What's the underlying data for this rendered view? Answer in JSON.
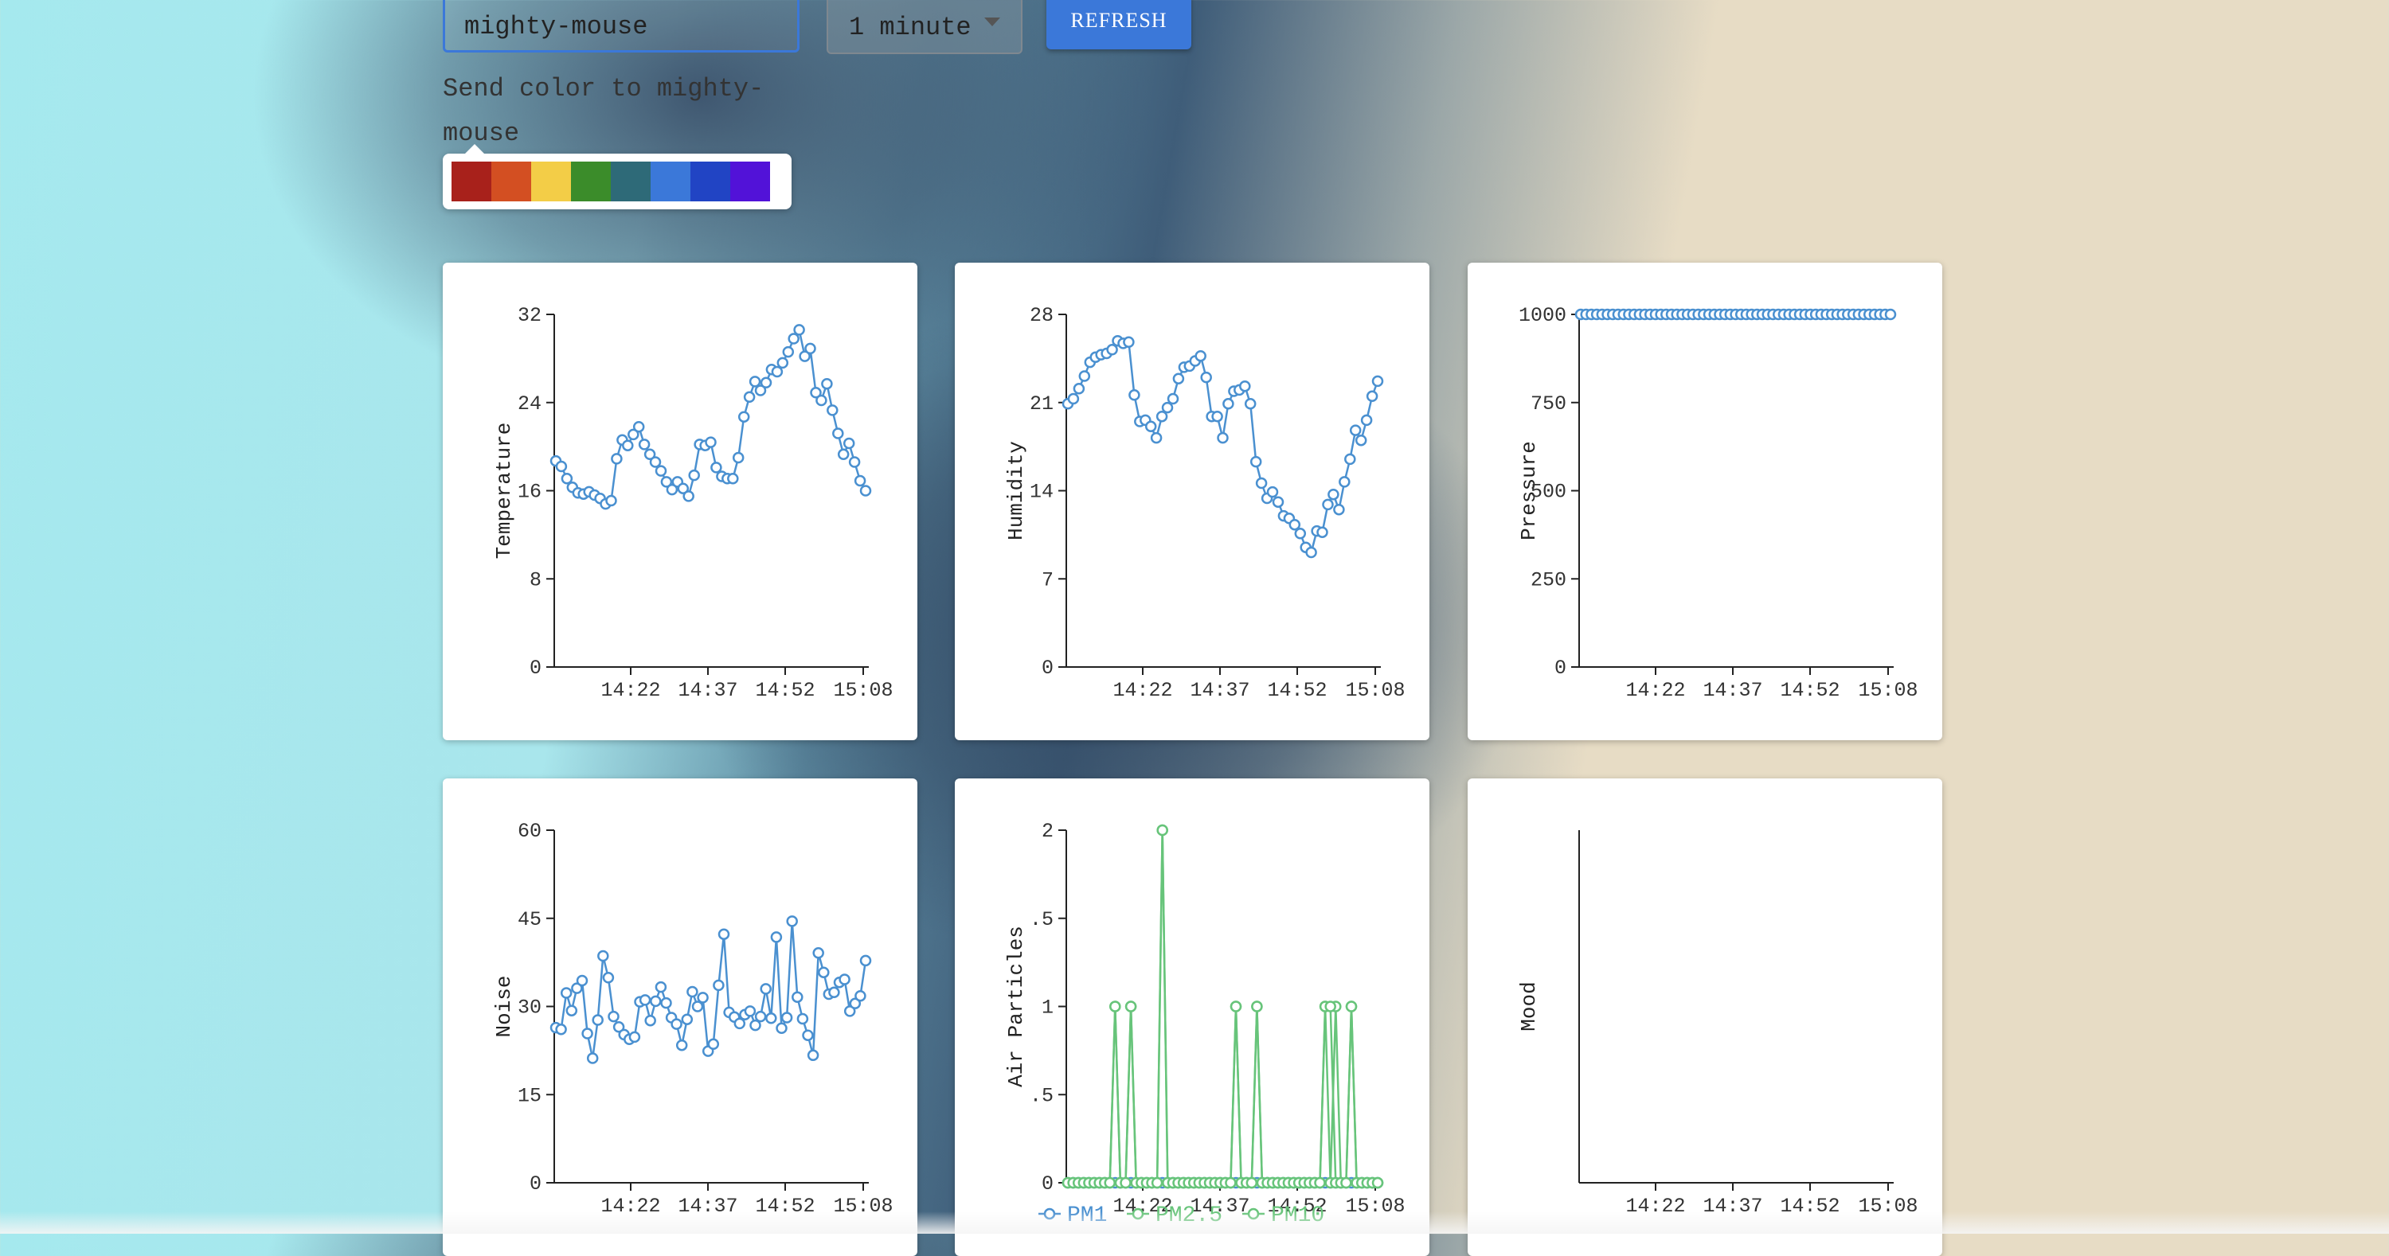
{
  "controls": {
    "device_value": "mighty-mouse",
    "interval_value": "1 minute",
    "refresh_label": "REFRESH",
    "send_color_label": "Send color to mighty-mouse",
    "palette_colors": [
      "#a8211b",
      "#d34f22",
      "#f3cd47",
      "#3b8c2a",
      "#2e6a78",
      "#3b78d9",
      "#2144c4",
      "#5212d8"
    ]
  },
  "colors": {
    "accent": "#3b78d9",
    "series_blue": "#4a90d0",
    "series_green": "#67c47a"
  },
  "chart_data": [
    {
      "type": "line",
      "ylabel": "Temperature",
      "ylim": [
        0,
        32
      ],
      "yticks": [
        0,
        8,
        16,
        24,
        32
      ],
      "xticks": [
        "14:22",
        "14:37",
        "14:52",
        "15:08"
      ],
      "series": [
        {
          "color": "#4a90d0",
          "values": [
            18.7,
            18.2,
            17.1,
            16.3,
            15.8,
            15.7,
            15.9,
            15.6,
            15.3,
            14.8,
            15.1,
            18.9,
            20.6,
            20.1,
            21.1,
            21.8,
            20.2,
            19.3,
            18.6,
            17.8,
            16.8,
            16.1,
            16.8,
            16.2,
            15.5,
            17.4,
            20.2,
            20.1,
            20.4,
            18.1,
            17.3,
            17.1,
            17.1,
            19.0,
            22.7,
            24.5,
            25.9,
            25.1,
            25.8,
            27.0,
            26.8,
            27.6,
            28.6,
            29.8,
            30.6,
            28.2,
            28.9,
            24.9,
            24.2,
            25.7,
            23.3,
            21.2,
            19.3,
            20.3,
            18.6,
            16.9,
            16.0
          ]
        }
      ]
    },
    {
      "type": "line",
      "ylabel": "Humidity",
      "ylim": [
        0,
        28
      ],
      "yticks": [
        0,
        7,
        14,
        21,
        28
      ],
      "xticks": [
        "14:22",
        "14:37",
        "14:52",
        "15:08"
      ],
      "series": [
        {
          "color": "#4a90d0",
          "values": [
            20.9,
            21.3,
            22.1,
            23.1,
            24.2,
            24.6,
            24.8,
            24.9,
            25.2,
            25.9,
            25.7,
            25.8,
            21.6,
            19.5,
            19.6,
            19.1,
            18.2,
            19.9,
            20.6,
            21.3,
            22.9,
            23.8,
            23.9,
            24.3,
            24.7,
            23.0,
            19.9,
            19.9,
            18.2,
            20.9,
            21.9,
            22.0,
            22.3,
            20.9,
            16.3,
            14.6,
            13.4,
            13.9,
            13.1,
            12.0,
            11.8,
            11.3,
            10.6,
            9.5,
            9.1,
            10.8,
            10.7,
            12.9,
            13.7,
            12.5,
            14.7,
            16.5,
            18.8,
            18.0,
            19.6,
            21.5,
            22.7
          ]
        }
      ]
    },
    {
      "type": "line",
      "ylabel": "Pressure",
      "ylim": [
        0,
        1000
      ],
      "yticks": [
        0,
        250,
        500,
        750,
        1000
      ],
      "xticks": [
        "14:22",
        "14:37",
        "14:52",
        "15:08"
      ],
      "series": [
        {
          "color": "#4a90d0",
          "values": [
            1000,
            1000,
            1000,
            1000,
            1000,
            1000,
            1000,
            1000,
            1000,
            1000,
            1000,
            1000,
            1000,
            1000,
            1000,
            1000,
            1000,
            1000,
            1000,
            1000,
            1000,
            1000,
            1000,
            1000,
            1000,
            1000,
            1000,
            1000,
            1000,
            1000,
            1000,
            1000,
            1000,
            1000,
            1000,
            1000,
            1000,
            1000,
            1000,
            1000,
            1000,
            1000,
            1000,
            1000,
            1000,
            1000,
            1000,
            1000,
            1000,
            1000,
            1000,
            1000,
            1000,
            1000,
            1000,
            1000,
            1000,
            1000,
            1000
          ]
        }
      ]
    },
    {
      "type": "line",
      "ylabel": "Noise",
      "ylim": [
        0,
        60
      ],
      "yticks": [
        0,
        15,
        30,
        45,
        60
      ],
      "xticks": [
        "14:22",
        "14:37",
        "14:52",
        "15:08"
      ],
      "series": [
        {
          "color": "#4a90d0",
          "values": [
            26.4,
            26.1,
            32.3,
            29.3,
            33.1,
            34.4,
            25.4,
            21.2,
            27.7,
            38.6,
            34.9,
            28.3,
            26.5,
            25.2,
            24.4,
            24.8,
            30.8,
            31.1,
            27.6,
            30.9,
            33.3,
            30.6,
            28.1,
            27.0,
            23.4,
            27.8,
            32.5,
            30.0,
            31.5,
            22.4,
            23.6,
            33.6,
            42.3,
            29.0,
            28.2,
            27.1,
            28.6,
            29.2,
            26.8,
            28.3,
            33.0,
            28.0,
            41.8,
            26.3,
            28.1,
            44.5,
            31.6,
            27.9,
            25.1,
            21.7,
            39.1,
            35.8,
            32.1,
            32.4,
            34.1,
            34.6,
            29.2,
            30.5,
            31.8,
            37.8
          ]
        }
      ]
    },
    {
      "type": "line",
      "ylabel": "Air Particles",
      "ylim": [
        0,
        2
      ],
      "yticks": [
        0,
        0.5,
        1,
        1.5,
        2
      ],
      "xticks": [
        "14:22",
        "14:37",
        "14:52",
        "15:08"
      ],
      "series": [
        {
          "name": "PM1",
          "color": "#4a90d0",
          "values": [
            0,
            0,
            0,
            0,
            0,
            0,
            0,
            0,
            0,
            0,
            0,
            0,
            0,
            0,
            0,
            0,
            0,
            0,
            0,
            0,
            0,
            0,
            0,
            0,
            0,
            0,
            0,
            0,
            0,
            0,
            0,
            0,
            0,
            0,
            0,
            0,
            0,
            0,
            0,
            0,
            0,
            0,
            0,
            0,
            0,
            0,
            0,
            0,
            0,
            0,
            0,
            0,
            0,
            0,
            0,
            0,
            0,
            0,
            0,
            0
          ]
        },
        {
          "name": "PM2.5",
          "color": "#67c47a",
          "values": [
            0,
            0,
            0,
            0,
            0,
            0,
            0,
            0,
            0,
            1,
            0,
            0,
            1,
            0,
            0,
            0,
            0,
            0,
            2,
            0,
            0,
            0,
            0,
            0,
            0,
            0,
            0,
            0,
            0,
            0,
            0,
            0,
            1,
            0,
            0,
            0,
            1,
            0,
            0,
            0,
            0,
            0,
            0,
            0,
            0,
            0,
            0,
            0,
            0,
            1,
            0,
            1,
            0,
            0,
            1,
            0,
            0,
            0,
            0,
            0
          ]
        },
        {
          "name": "PM10",
          "color": "#67c47a",
          "values": [
            0,
            0,
            0,
            0,
            0,
            0,
            0,
            0,
            0,
            1,
            0,
            0,
            1,
            0,
            0,
            0,
            0,
            0,
            2,
            0,
            0,
            0,
            0,
            0,
            0,
            0,
            0,
            0,
            0,
            0,
            0,
            0,
            1,
            0,
            0,
            0,
            1,
            0,
            0,
            0,
            0,
            0,
            0,
            0,
            0,
            0,
            0,
            0,
            0,
            1,
            1,
            0,
            0,
            0,
            1,
            0,
            0,
            0,
            0,
            0
          ]
        }
      ],
      "ytick_labels": [
        "0",
        ".5",
        "1",
        ".5",
        "2"
      ]
    },
    {
      "type": "line",
      "ylabel": "Mood",
      "yticks": [],
      "xticks": [
        "14:22",
        "14:37",
        "14:52",
        "15:08"
      ],
      "series": []
    }
  ]
}
